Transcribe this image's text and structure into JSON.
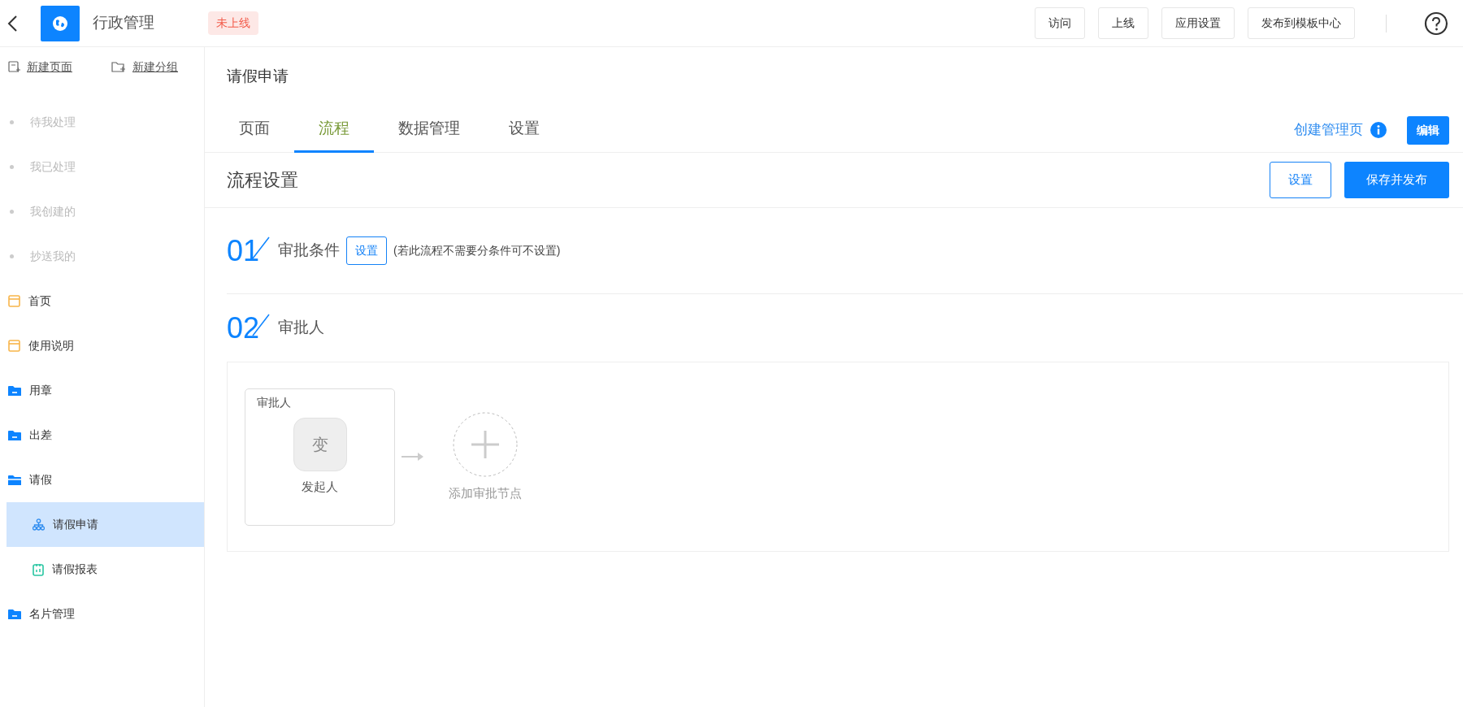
{
  "header": {
    "app_title": "行政管理",
    "status_badge": "未上线",
    "buttons": [
      "访问",
      "上线",
      "应用设置",
      "发布到模板中心"
    ]
  },
  "sidebar": {
    "actions": [
      {
        "kind": "new-page",
        "label": "新建页面"
      },
      {
        "kind": "new-group",
        "label": "新建分组"
      }
    ],
    "items": [
      {
        "kind": "task",
        "label": "待我处理",
        "selected": false
      },
      {
        "kind": "task",
        "label": "我已处理",
        "selected": false
      },
      {
        "kind": "task",
        "label": "我创建的",
        "selected": false
      },
      {
        "kind": "task",
        "label": "抄送我的",
        "selected": false
      },
      {
        "kind": "page",
        "label": "首页",
        "selected": false
      },
      {
        "kind": "page",
        "label": "使用说明",
        "selected": false
      },
      {
        "kind": "folder",
        "label": "用章",
        "selected": false,
        "expanded": false
      },
      {
        "kind": "folder",
        "label": "出差",
        "selected": false,
        "expanded": false
      },
      {
        "kind": "folder",
        "label": "请假",
        "selected": false,
        "expanded": true,
        "children": [
          {
            "kind": "flow",
            "label": "请假申请",
            "selected": true
          },
          {
            "kind": "report",
            "label": "请假报表",
            "selected": false
          }
        ]
      },
      {
        "kind": "folder",
        "label": "名片管理",
        "selected": false,
        "expanded": false
      }
    ]
  },
  "main": {
    "page_title": "请假申请",
    "tabs": [
      {
        "label": "页面",
        "selected": false
      },
      {
        "label": "流程",
        "selected": true
      },
      {
        "label": "数据管理",
        "selected": false
      },
      {
        "label": "设置",
        "selected": false
      }
    ],
    "create_link": "创建管理页",
    "edit_button": "编辑",
    "section_title": "流程设置",
    "section_buttons": {
      "settings": "设置",
      "publish": "保存并发布"
    },
    "steps": [
      {
        "number": "01",
        "title": "审批条件",
        "button": "设置",
        "note": "(若此流程不需要分条件可不设置)"
      },
      {
        "number": "02",
        "title": "审批人"
      }
    ],
    "flow": {
      "node": {
        "title": "审批人",
        "avatar": "变",
        "name": "发起人"
      },
      "add_label": "添加审批节点"
    }
  }
}
